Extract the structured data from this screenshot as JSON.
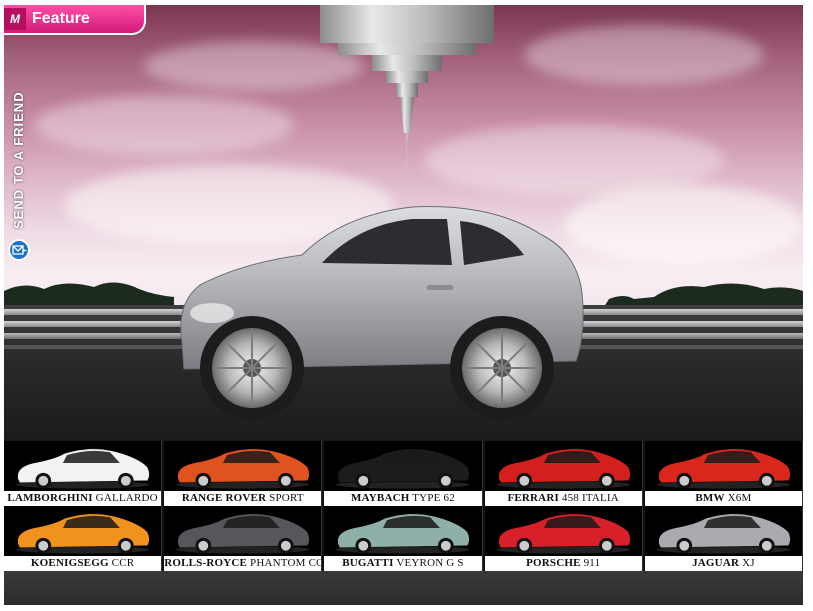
{
  "brand": {
    "logo": "M",
    "label": "Feature"
  },
  "send": {
    "label": "SEND TO A FRIEND",
    "icon": "mail-icon"
  },
  "cars": [
    {
      "make": "LAMBORGHINI",
      "model": "GALLARDO",
      "color": "#f2f2f2"
    },
    {
      "make": "RANGE ROVER",
      "model": "SPORT",
      "color": "#e0531e"
    },
    {
      "make": "MAYBACH",
      "model": "TYPE 62",
      "color": "#1c1c1c"
    },
    {
      "make": "FERRARI",
      "model": "458 ITALIA",
      "color": "#d2201c"
    },
    {
      "make": "BMW",
      "model": "X6M",
      "color": "#d8281e"
    },
    {
      "make": "KOENIGSEGG",
      "model": "CCR",
      "color": "#f0921e"
    },
    {
      "make": "ROLLS-ROYCE",
      "model": "PHANTOM COUPÉ",
      "color": "#55575c"
    },
    {
      "make": "BUGATTI",
      "model": "VEYRON G S",
      "color": "#8fb0a8"
    },
    {
      "make": "PORSCHE",
      "model": "911",
      "color": "#d8202a"
    },
    {
      "make": "JAGUAR",
      "model": "XJ",
      "color": "#a9abb0"
    }
  ],
  "colors": {
    "brand_pink": "#e0288a",
    "hero_car": "#b7b9bd"
  }
}
